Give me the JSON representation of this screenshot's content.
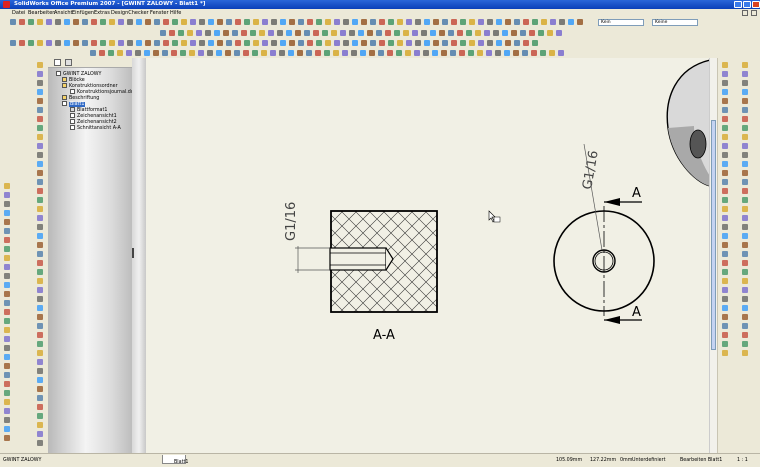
{
  "window": {
    "title": "SolidWorks Office Premium 2007 - [GWINT ZALOWY - Blatt1 *]"
  },
  "menu": [
    "Datei",
    "Bearbeiten",
    "Ansicht",
    "Einfügen",
    "Extras",
    "DesignChecker",
    "Fenster",
    "Hilfe"
  ],
  "toolbar": {
    "style_select": "Kein",
    "style_select2": "Keine"
  },
  "tree": {
    "root": "GWINT ZALOWY",
    "items": [
      {
        "label": "Blöcke",
        "level": 1
      },
      {
        "label": "Konstruktionsordner",
        "level": 1
      },
      {
        "label": "Konstruktionsjournal.doc",
        "level": 2
      },
      {
        "label": "Beschriftung",
        "level": 1
      },
      {
        "label": "Blatt1",
        "level": 1
      },
      {
        "label": "Blattformat1",
        "level": 2
      },
      {
        "label": "Zeichenansicht1",
        "level": 2
      },
      {
        "label": "Zeichenansicht2",
        "level": 2
      },
      {
        "label": "Schnittansicht A-A",
        "level": 2
      }
    ]
  },
  "drawing": {
    "section_label": "A-A",
    "thread_callout_left": "G1/16",
    "thread_callout_right": "G1/16",
    "section_arrow_top": "A",
    "section_arrow_bottom": "A"
  },
  "status": {
    "left": "GWINT ZALOWY",
    "sheet_tab": "Blatt1",
    "x": "105.09mm",
    "y": "127.22mm",
    "z": "0mm",
    "state": "Unterdefiniert",
    "mode": "Bearbeiten Blatt1",
    "scale": "1 : 1"
  },
  "colors": {
    "titlebar": "#0a3fb8",
    "sheet": "#f1f0e5",
    "chrome": "#ece9d8"
  }
}
